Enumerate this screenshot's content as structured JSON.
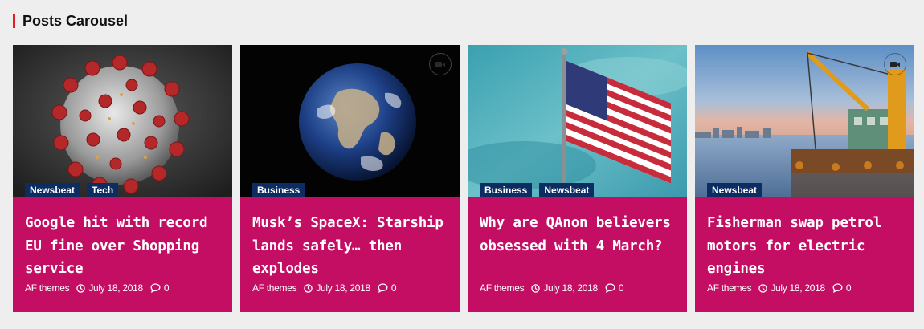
{
  "widget": {
    "title": "Posts Carousel",
    "accent_color": "#e31e24"
  },
  "colors": {
    "card_bg": "#c40e63",
    "tag_bg": "#0b2d62"
  },
  "posts": [
    {
      "image": "coronavirus-image",
      "video_icon": false,
      "tags": [
        "Newsbeat",
        "Tech"
      ],
      "title": "Google hit with record EU fine over Shopping service",
      "author": "AF themes",
      "date": "July 18, 2018",
      "comments": "0"
    },
    {
      "image": "earth-image",
      "video_icon": true,
      "tags": [
        "Business"
      ],
      "title": "Musk’s SpaceX: Starship lands safely… then explodes",
      "author": "AF themes",
      "date": "July 18, 2018",
      "comments": "0"
    },
    {
      "image": "us-flag-image",
      "video_icon": false,
      "tags": [
        "Business",
        "Newsbeat"
      ],
      "title": "Why are QAnon believers obsessed with 4 March?",
      "author": "AF themes",
      "date": "July 18, 2018",
      "comments": "0"
    },
    {
      "image": "crane-ship-image",
      "video_icon": true,
      "tags": [
        "Newsbeat"
      ],
      "title": "Fisherman swap petrol motors for electric engines",
      "author": "AF themes",
      "date": "July 18, 2018",
      "comments": "0"
    }
  ]
}
